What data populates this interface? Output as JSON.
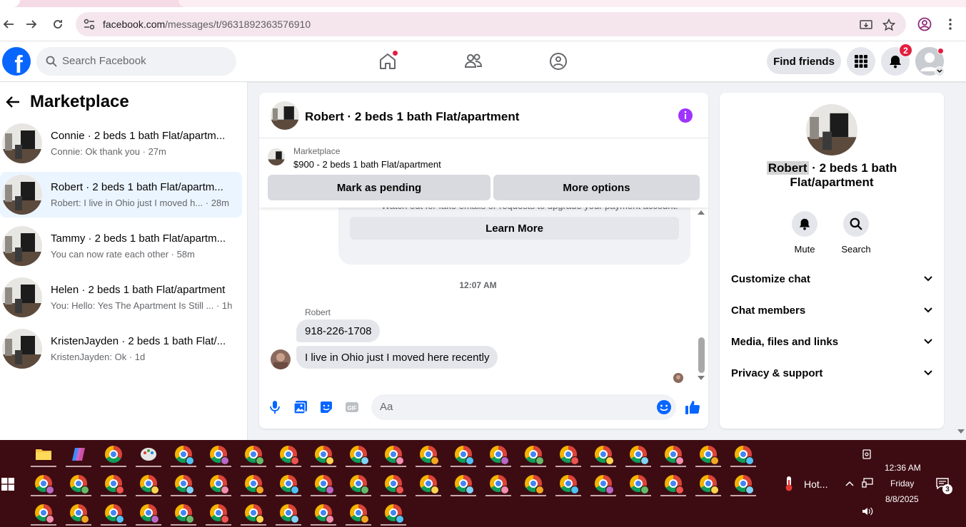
{
  "browser": {
    "url_host": "facebook.com",
    "url_path": "/messages/t/9631892363576910"
  },
  "fb": {
    "logo_letter": "f",
    "search_placeholder": "Search Facebook",
    "find_friends": "Find friends",
    "notifications_count": "2"
  },
  "left": {
    "title": "Marketplace",
    "conversations": [
      {
        "name": "Connie · 2 beds 1 bath Flat/apartm...",
        "preview": "Connie: Ok thank you · 27m"
      },
      {
        "name": "Robert · 2 beds 1 bath Flat/apartm...",
        "preview": "Robert: I live in Ohio just I moved h... · 28m"
      },
      {
        "name": "Tammy · 2 beds 1 bath Flat/apartm...",
        "preview": "You can now rate each other · 58m"
      },
      {
        "name": "Helen · 2 beds 1 bath Flat/apartment",
        "preview": "You: Hello: Yes The Apartment Is Still ... · 1h"
      },
      {
        "name": "KristenJayden · 2 beds 1 bath Flat/...",
        "preview": "KristenJayden: Ok · 1d"
      }
    ]
  },
  "chat": {
    "title": "Robert · 2 beds 1 bath Flat/apartment",
    "marketplace_label": "Marketplace",
    "listing": "$900 - 2 beds 1 bath Flat/apartment",
    "mark_pending": "Mark as pending",
    "more_options": "More options",
    "safety_text": "Watch out for fake emails or requests to upgrade your payment account.",
    "learn_more": "Learn More",
    "timestamp": "12:07 AM",
    "sender": "Robert",
    "messages": [
      "918-226-1708",
      "I live in Ohio just I moved here recently"
    ],
    "composer_placeholder": "Aa"
  },
  "right": {
    "name_highlight": "Robert",
    "name_rest": " · 2 beds 1 bath Flat/apartment",
    "mute": "Mute",
    "search": "Search",
    "sections": [
      "Customize chat",
      "Chat members",
      "Media, files and links",
      "Privacy & support"
    ]
  },
  "taskbar": {
    "weather": "Hot...",
    "time": "12:36 AM",
    "day": "Friday",
    "date": "8/8/2025",
    "notif_count": "3"
  }
}
